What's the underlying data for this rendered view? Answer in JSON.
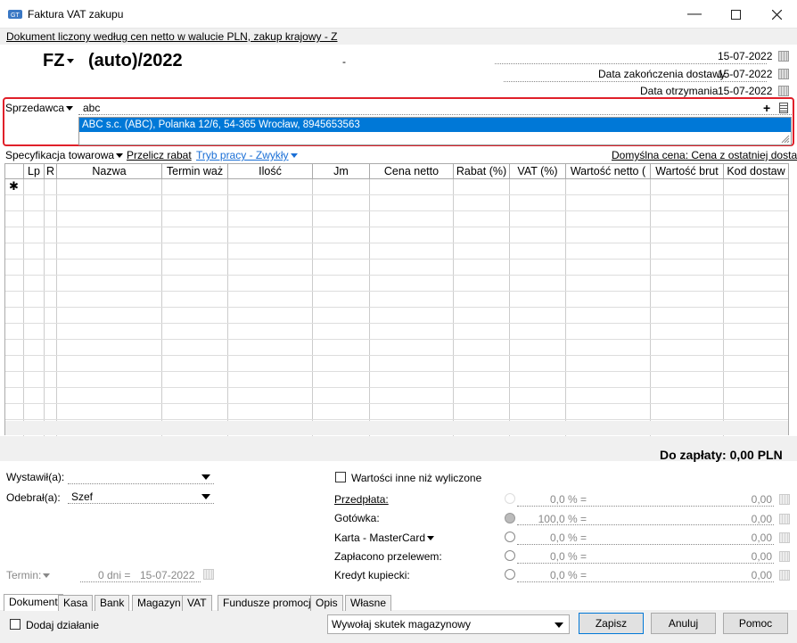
{
  "window": {
    "title": "Faktura VAT zakupu"
  },
  "info_bar": "Dokument liczony według cen netto w walucie PLN, zakup krajowy - Z",
  "doc": {
    "type": "FZ",
    "number": "(auto)/2022",
    "dash": "-"
  },
  "dates": [
    {
      "label": "",
      "value": "15-07-2022"
    },
    {
      "label": "Data zakończenia dostawy",
      "value": "15-07-2022"
    },
    {
      "label": "Data otrzymania",
      "value": "15-07-2022"
    }
  ],
  "seller": {
    "label": "Sprzedawca",
    "input": "abc",
    "suggestion": "ABC s.c. (ABC), Polanka  12/6, 54-365 Wrocław, 8945653563"
  },
  "toolbar": {
    "spec": "Specyfikacja towarowa",
    "recalc": "Przelicz rabat",
    "mode": "Tryb pracy - Zwykły",
    "default_price": "Domyślna cena: Cena z ostatniej dostawy"
  },
  "grid": {
    "headers": [
      "Lp",
      "R",
      "Nazwa",
      "Termin waż",
      "Ilość",
      "Jm",
      "Cena netto",
      "Rabat (%)",
      "VAT (%)",
      "Wartość netto (",
      "Wartość brut",
      "Kod dostaw"
    ],
    "new_row_marker": "✱"
  },
  "total": "Do zapłaty: 0,00 PLN",
  "people": {
    "issued_label": "Wystawił(a):",
    "issued_value": "",
    "received_label": "Odebrał(a):",
    "received_value": "Szef"
  },
  "term": {
    "label": "Termin:",
    "days": "0 dni =",
    "date": "15-07-2022"
  },
  "other_values": "Wartości inne niż wyliczone",
  "payments": [
    {
      "label": "Przedpłata:",
      "pct": "0,0 % =",
      "amount": "0,00"
    },
    {
      "label": "Gotówka:",
      "pct": "100,0 % =",
      "amount": "0,00"
    },
    {
      "label": "Karta - MasterCard",
      "pct": "0,0 % =",
      "amount": "0,00"
    },
    {
      "label": "Zapłacono przelewem:",
      "pct": "0,0 % =",
      "amount": "0,00"
    },
    {
      "label": "Kredyt kupiecki:",
      "pct": "0,0 % =",
      "amount": "0,00"
    }
  ],
  "tabs": [
    "Dokument",
    "Kasa",
    "Bank",
    "Magazyn",
    "VAT",
    "Fundusze promocji",
    "Opis",
    "Własne"
  ],
  "footer": {
    "add_action": "Dodaj działanie",
    "warehouse": "Wywołaj skutek magazynowy",
    "save": "Zapisz",
    "cancel": "Anuluj",
    "help": "Pomoc"
  },
  "colors": {
    "accent": "#0078d7",
    "highlight_border": "#e0202a",
    "link_blue": "#1a6fd6"
  }
}
